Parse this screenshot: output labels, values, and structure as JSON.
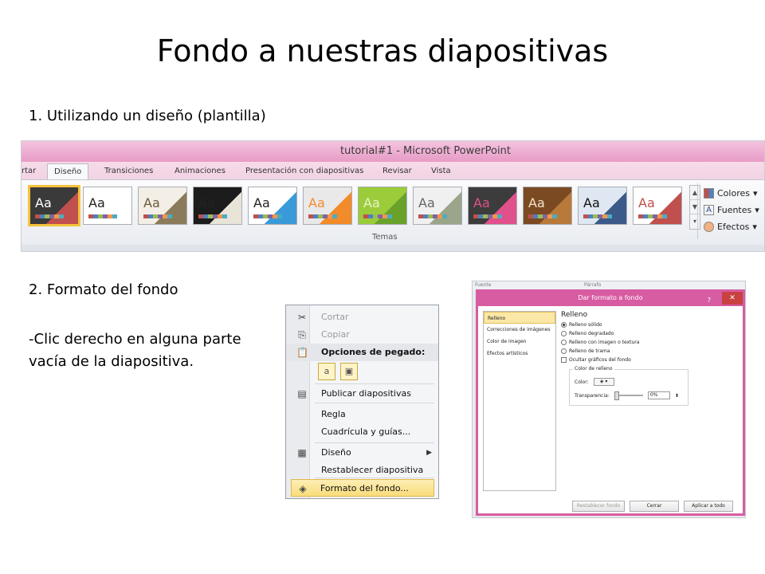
{
  "slide": {
    "title": "Fondo a nuestras diapositivas",
    "step1": "1. Utilizando un diseño (plantilla)",
    "step2": "2. Formato del fondo",
    "instruction": "-Clic derecho en alguna parte vacía de la diapositiva."
  },
  "ribbon": {
    "window_title": "tutorial#1 - Microsoft PowerPoint",
    "tabs": [
      "rtar",
      "Diseño",
      "Transiciones",
      "Animaciones",
      "Presentación con diapositivas",
      "Revisar",
      "Vista"
    ],
    "active_tab": "Diseño",
    "theme_sample": "Aa",
    "group_label": "Temas",
    "options": [
      "Colores",
      "Fuentes",
      "Efectos"
    ],
    "themes": [
      {
        "name": "theme-1",
        "bg": "#3a3a3a",
        "accent": "#c0504d",
        "text": "#ffffff"
      },
      {
        "name": "theme-2",
        "bg": "#ffffff",
        "accent": "#ffffff",
        "text": "#222222"
      },
      {
        "name": "theme-3",
        "bg": "#f4efe6",
        "accent": "#8b7b5a",
        "text": "#6b5a3a"
      },
      {
        "name": "theme-4",
        "bg": "#1c1c1c",
        "accent": "#e8e4d8",
        "text": "#222222"
      },
      {
        "name": "theme-5",
        "bg": "#ffffff",
        "accent": "#3a9ad9",
        "text": "#222222"
      },
      {
        "name": "theme-6",
        "bg": "#e9e9e9",
        "accent": "#f28b2a",
        "text": "#f28b2a"
      },
      {
        "name": "theme-7",
        "bg": "#9ccc3a",
        "accent": "#6aa12a",
        "text": "#e8f5c8"
      },
      {
        "name": "theme-8",
        "bg": "#f0f0f0",
        "accent": "#9aa58a",
        "text": "#666666"
      },
      {
        "name": "theme-9",
        "bg": "#3c3c3c",
        "accent": "#e0508a",
        "text": "#e0508a"
      },
      {
        "name": "theme-10",
        "bg": "#7b4a22",
        "accent": "#b8793a",
        "text": "#f4e3c8"
      },
      {
        "name": "theme-11",
        "bg": "#dfe7f2",
        "accent": "#3b5a8a",
        "text": "#111111"
      },
      {
        "name": "theme-12",
        "bg": "#ffffff",
        "accent": "#c0504d",
        "text": "#c0504d"
      }
    ]
  },
  "context_menu": {
    "items": [
      {
        "label": "Cortar",
        "icon": "scissors-icon",
        "glyph": "✂",
        "state": "disabled"
      },
      {
        "label": "Copiar",
        "icon": "copy-icon",
        "glyph": "⎘",
        "state": "disabled"
      },
      {
        "label": "Opciones de pegado:",
        "icon": "paste-icon",
        "glyph": "📋",
        "state": "header"
      },
      {
        "label": "Publicar diapositivas",
        "icon": "publish-icon",
        "glyph": "▤",
        "state": "normal"
      },
      {
        "label": "Regla",
        "icon": "",
        "glyph": "",
        "state": "normal"
      },
      {
        "label": "Cuadrícula y guías...",
        "icon": "",
        "glyph": "",
        "state": "normal"
      },
      {
        "label": "Diseño",
        "icon": "layout-icon",
        "glyph": "▦",
        "state": "normal",
        "submenu": true
      },
      {
        "label": "Restablecer diapositiva",
        "icon": "",
        "glyph": "",
        "state": "normal"
      },
      {
        "label": "Formato del fondo...",
        "icon": "paint-bucket-icon",
        "glyph": "◈",
        "state": "hover"
      }
    ],
    "paste_buttons": [
      "a",
      "▣"
    ]
  },
  "dialog": {
    "bg_labels": [
      "Fuente",
      "Párrafo"
    ],
    "title": "Dar formato a fondo",
    "help": "?",
    "close": "✕",
    "nav": [
      "Relleno",
      "Correcciones de imágenes",
      "Color de imagen",
      "Efectos artísticos"
    ],
    "nav_selected": "Relleno",
    "pane_title": "Relleno",
    "fill_options": [
      {
        "label": "Relleno sólido",
        "checked": true
      },
      {
        "label": "Relleno degradado",
        "checked": false
      },
      {
        "label": "Relleno con imagen o textura",
        "checked": false
      },
      {
        "label": "Relleno de trama",
        "checked": false
      }
    ],
    "hide_graphics": "Ocultar gráficos del fondo",
    "fill_color_group": "Color de relleno",
    "color_label": "Color:",
    "color_value": "◈ ▾",
    "transparency_label": "Transparencia:",
    "transparency_value": "0%",
    "buttons": {
      "reset": "Restablecer fondo",
      "close": "Cerrar",
      "apply_all": "Aplicar a todo"
    }
  }
}
